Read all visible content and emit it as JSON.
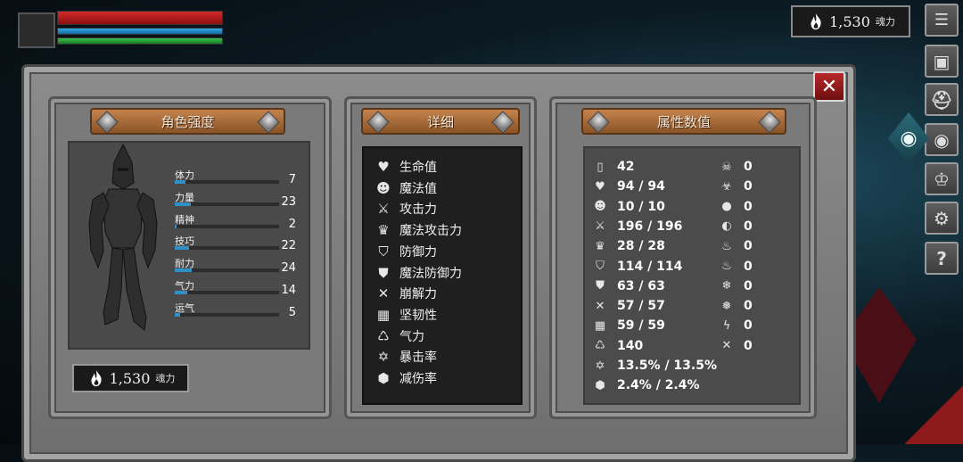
{
  "hud": {
    "soul_value": "1,530",
    "soul_unit": "魂力",
    "colors": {
      "hp": "#c0201f",
      "mp": "#2590d0",
      "sp": "#2aa83a"
    }
  },
  "menu": [
    "list-icon",
    "equipment-icon",
    "helmet-icon",
    "relic-icon",
    "crown-icon",
    "gear-icon",
    "help-icon"
  ],
  "panels": {
    "character": {
      "title": "角色强度",
      "stats": [
        {
          "name": "体力",
          "value": "7",
          "fill": 0.1
        },
        {
          "name": "力量",
          "value": "23",
          "fill": 0.15
        },
        {
          "name": "精神",
          "value": "2",
          "fill": 0.02
        },
        {
          "name": "技巧",
          "value": "22",
          "fill": 0.14
        },
        {
          "name": "耐力",
          "value": "24",
          "fill": 0.16
        },
        {
          "name": "气力",
          "value": "14",
          "fill": 0.12
        },
        {
          "name": "运气",
          "value": "5",
          "fill": 0.05
        }
      ],
      "soul_value": "1,530",
      "soul_unit": "魂力"
    },
    "detail": {
      "title": "详细",
      "items": [
        {
          "label": "生命值",
          "icon": "heart-icon",
          "glyph": "♥"
        },
        {
          "label": "魔法值",
          "icon": "head-icon",
          "glyph": "☻"
        },
        {
          "label": "攻击力",
          "icon": "sword-icon",
          "glyph": "⚔"
        },
        {
          "label": "魔法攻击力",
          "icon": "magic-attack-icon",
          "glyph": "♛"
        },
        {
          "label": "防御力",
          "icon": "shield-icon",
          "glyph": "⛉"
        },
        {
          "label": "魔法防御力",
          "icon": "magic-shield-icon",
          "glyph": "⛊"
        },
        {
          "label": "崩解力",
          "icon": "break-icon",
          "glyph": "✕"
        },
        {
          "label": "坚韧性",
          "icon": "toughness-icon",
          "glyph": "▦"
        },
        {
          "label": "气力",
          "icon": "lungs-icon",
          "glyph": "♺"
        },
        {
          "label": "暴击率",
          "icon": "crit-icon",
          "glyph": "✡"
        },
        {
          "label": "减伤率",
          "icon": "reduce-icon",
          "glyph": "⬢"
        }
      ]
    },
    "attributes": {
      "title": "属性数值",
      "left": [
        {
          "value": "42",
          "icon": "armor-icon",
          "glyph": "▯"
        },
        {
          "value": "94 / 94",
          "icon": "heart-icon",
          "glyph": "♥"
        },
        {
          "value": "10 / 10",
          "icon": "head-icon",
          "glyph": "☻"
        },
        {
          "value": "196 / 196",
          "icon": "sword-icon",
          "glyph": "⚔"
        },
        {
          "value": "28 / 28",
          "icon": "magic-attack-icon",
          "glyph": "♛"
        },
        {
          "value": "114 / 114",
          "icon": "shield-icon",
          "glyph": "⛉"
        },
        {
          "value": "63 / 63",
          "icon": "magic-shield-icon",
          "glyph": "⛊"
        },
        {
          "value": "57 / 57",
          "icon": "break-icon",
          "glyph": "✕"
        },
        {
          "value": "59 / 59",
          "icon": "toughness-icon",
          "glyph": "▦"
        },
        {
          "value": "140",
          "icon": "lungs-icon",
          "glyph": "♺"
        },
        {
          "value": "13.5% / 13.5%",
          "icon": "crit-icon",
          "glyph": "✡"
        },
        {
          "value": "2.4% / 2.4%",
          "icon": "reduce-icon",
          "glyph": "⬢"
        }
      ],
      "right": [
        {
          "value": "0",
          "icon": "skull-icon",
          "glyph": "☠"
        },
        {
          "value": "0",
          "icon": "poison-icon",
          "glyph": "☣"
        },
        {
          "value": "0",
          "icon": "blood-icon",
          "glyph": "●"
        },
        {
          "value": "0",
          "icon": "bleed-icon",
          "glyph": "◐"
        },
        {
          "value": "0",
          "icon": "fire-icon",
          "glyph": "♨"
        },
        {
          "value": "0",
          "icon": "burn-icon",
          "glyph": "♨"
        },
        {
          "value": "0",
          "icon": "frost-icon",
          "glyph": "❄"
        },
        {
          "value": "0",
          "icon": "freeze-icon",
          "glyph": "❅"
        },
        {
          "value": "0",
          "icon": "lightning-icon",
          "glyph": "ϟ"
        },
        {
          "value": "0",
          "icon": "shock-icon",
          "glyph": "✕"
        }
      ]
    }
  }
}
